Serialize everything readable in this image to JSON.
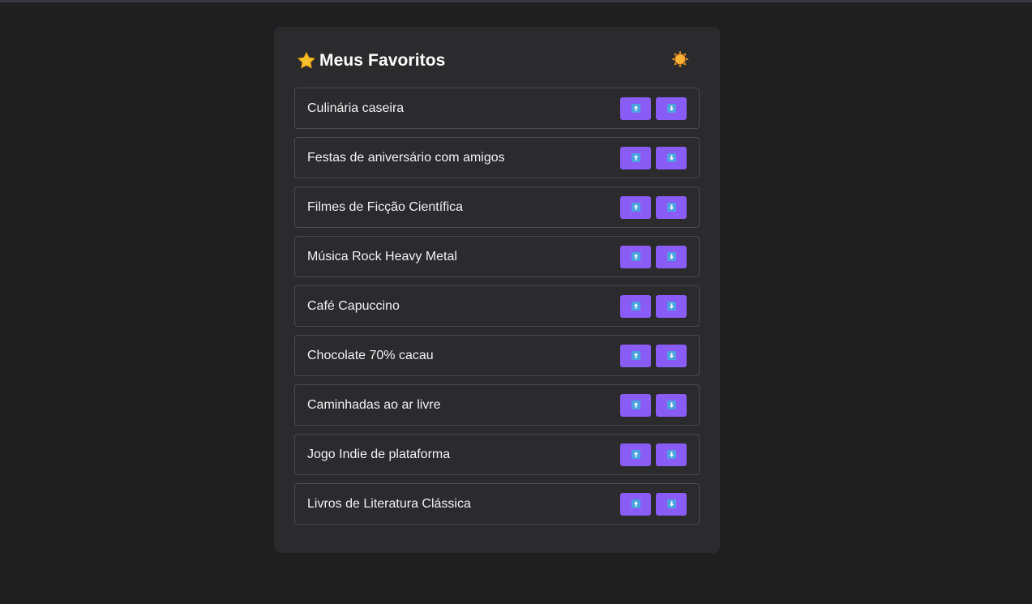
{
  "header": {
    "title": "Meus Favoritos",
    "title_icon": "star-icon",
    "theme_toggle_icon": "sun-icon"
  },
  "colors": {
    "background": "#1f1f1f",
    "card": "#2b2b2e",
    "accent_button": "#8a5cf6",
    "arrow_icon": "#4aa3df",
    "item_border": "#4a4a4f"
  },
  "items": [
    {
      "label": "Culinária caseira",
      "up_icon": "arrow-up-icon",
      "down_icon": "arrow-down-icon"
    },
    {
      "label": "Festas de aniversário com amigos",
      "up_icon": "arrow-up-icon",
      "down_icon": "arrow-down-icon"
    },
    {
      "label": "Filmes de Ficção Científica",
      "up_icon": "arrow-up-icon",
      "down_icon": "arrow-down-icon"
    },
    {
      "label": "Música Rock Heavy Metal",
      "up_icon": "arrow-up-icon",
      "down_icon": "arrow-down-icon"
    },
    {
      "label": "Café Capuccino",
      "up_icon": "arrow-up-icon",
      "down_icon": "arrow-down-icon"
    },
    {
      "label": "Chocolate 70% cacau",
      "up_icon": "arrow-up-icon",
      "down_icon": "arrow-down-icon"
    },
    {
      "label": "Caminhadas ao ar livre",
      "up_icon": "arrow-up-icon",
      "down_icon": "arrow-down-icon"
    },
    {
      "label": "Jogo Indie de plataforma",
      "up_icon": "arrow-up-icon",
      "down_icon": "arrow-down-icon"
    },
    {
      "label": "Livros de Literatura Clássica",
      "up_icon": "arrow-up-icon",
      "down_icon": "arrow-down-icon"
    }
  ]
}
